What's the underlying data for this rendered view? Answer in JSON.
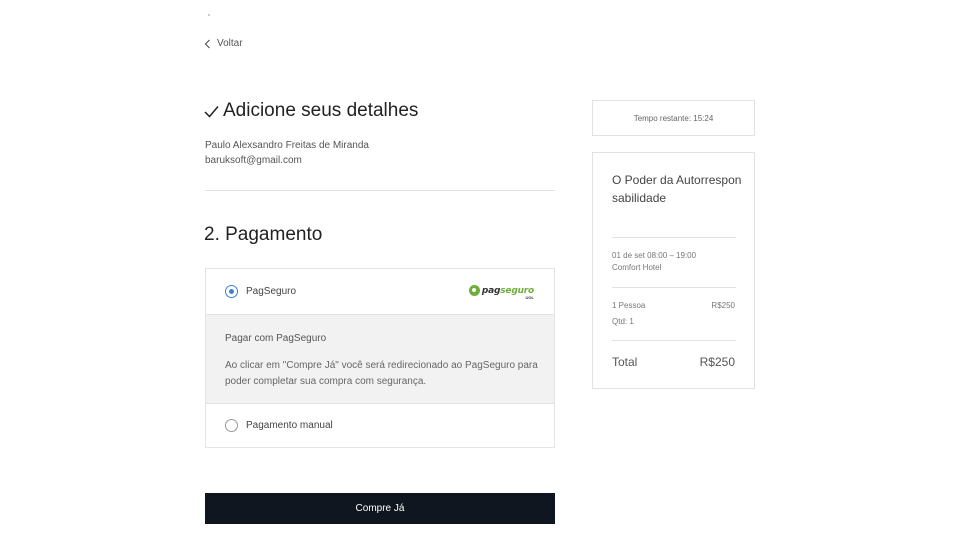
{
  "nav": {
    "back_label": "Voltar"
  },
  "details": {
    "title": "Adicione seus detalhes",
    "name": "Paulo Alexsandro Freitas de Miranda",
    "email": "baruksoft@gmail.com"
  },
  "payment": {
    "title": "2. Pagamento",
    "options": [
      {
        "label": "PagSeguro",
        "selected": true
      },
      {
        "label": "Pagamento manual",
        "selected": false
      }
    ],
    "logo": {
      "text_a": "pag",
      "text_b": "seguro",
      "sub": "UOL"
    },
    "panel_title": "Pagar com PagSeguro",
    "panel_desc": "Ao clicar em \"Compre Já\" você será redirecionado ao PagSeguro para poder completar sua compra com segurança."
  },
  "buy_button": "Compre Já",
  "timer": "Tempo restante: 15:24",
  "summary": {
    "event_title": "O Poder da Autorresponsabilidade",
    "datetime": "01 de set 08:00 – 19:00",
    "venue": "Comfort Hotel",
    "ticket_label": "1 Pessoa",
    "ticket_price": "R$250",
    "qty_label": "Qtd: 1",
    "total_label": "Total",
    "total_value": "R$250"
  },
  "colors": {
    "accent": "#3b82d6",
    "button_bg": "#0f1620",
    "logo_green": "#6fae3a"
  }
}
